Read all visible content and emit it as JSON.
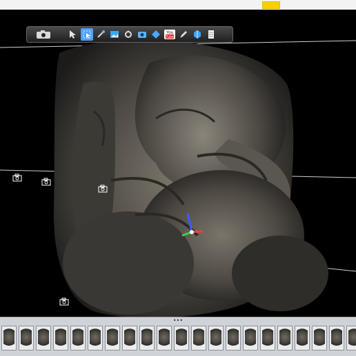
{
  "toolbar": {
    "buttons": [
      {
        "icon": "camera-icon",
        "name": "camera-button"
      },
      {
        "icon": "pointer-icon",
        "name": "select-button"
      },
      {
        "icon": "select-box-icon",
        "name": "box-select-button",
        "active": true
      },
      {
        "icon": "magic-wand-icon",
        "name": "magic-select-button"
      },
      {
        "icon": "photo-icon",
        "name": "photo-button"
      },
      {
        "icon": "orbit-icon",
        "name": "orbit-button"
      },
      {
        "icon": "screenshot-icon",
        "name": "screenshot-button"
      },
      {
        "icon": "diamond-icon",
        "name": "model-button"
      },
      {
        "icon": "youtube-icon",
        "name": "youtube-button",
        "label": "You Tube"
      },
      {
        "icon": "pen-icon",
        "name": "draw-button"
      },
      {
        "icon": "cube-icon",
        "name": "cube-button"
      },
      {
        "icon": "document-icon",
        "name": "report-button"
      }
    ]
  },
  "thumbnail_strip": {
    "grip": "•••",
    "thumb_count": 22
  }
}
